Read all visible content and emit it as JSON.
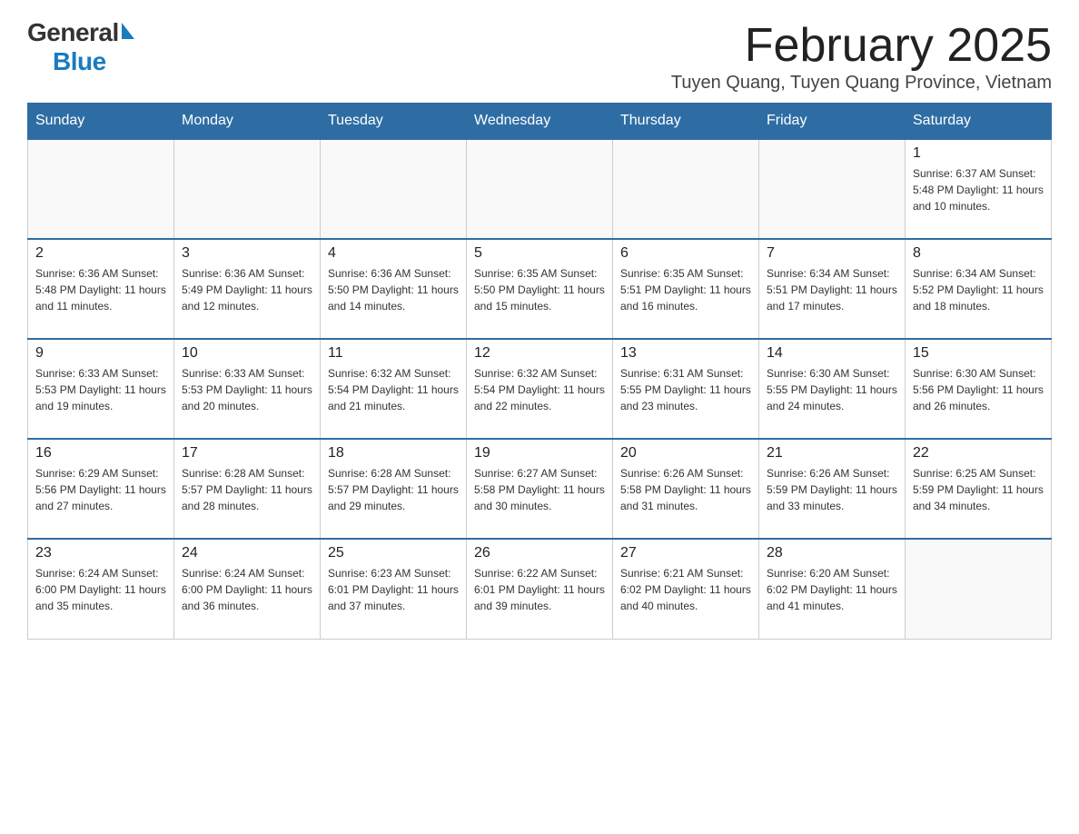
{
  "header": {
    "logo": {
      "general_text": "General",
      "blue_text": "Blue"
    },
    "title": "February 2025",
    "subtitle": "Tuyen Quang, Tuyen Quang Province, Vietnam"
  },
  "days_of_week": [
    "Sunday",
    "Monday",
    "Tuesday",
    "Wednesday",
    "Thursday",
    "Friday",
    "Saturday"
  ],
  "weeks": [
    [
      {
        "day": "",
        "info": ""
      },
      {
        "day": "",
        "info": ""
      },
      {
        "day": "",
        "info": ""
      },
      {
        "day": "",
        "info": ""
      },
      {
        "day": "",
        "info": ""
      },
      {
        "day": "",
        "info": ""
      },
      {
        "day": "1",
        "info": "Sunrise: 6:37 AM\nSunset: 5:48 PM\nDaylight: 11 hours and 10 minutes."
      }
    ],
    [
      {
        "day": "2",
        "info": "Sunrise: 6:36 AM\nSunset: 5:48 PM\nDaylight: 11 hours and 11 minutes."
      },
      {
        "day": "3",
        "info": "Sunrise: 6:36 AM\nSunset: 5:49 PM\nDaylight: 11 hours and 12 minutes."
      },
      {
        "day": "4",
        "info": "Sunrise: 6:36 AM\nSunset: 5:50 PM\nDaylight: 11 hours and 14 minutes."
      },
      {
        "day": "5",
        "info": "Sunrise: 6:35 AM\nSunset: 5:50 PM\nDaylight: 11 hours and 15 minutes."
      },
      {
        "day": "6",
        "info": "Sunrise: 6:35 AM\nSunset: 5:51 PM\nDaylight: 11 hours and 16 minutes."
      },
      {
        "day": "7",
        "info": "Sunrise: 6:34 AM\nSunset: 5:51 PM\nDaylight: 11 hours and 17 minutes."
      },
      {
        "day": "8",
        "info": "Sunrise: 6:34 AM\nSunset: 5:52 PM\nDaylight: 11 hours and 18 minutes."
      }
    ],
    [
      {
        "day": "9",
        "info": "Sunrise: 6:33 AM\nSunset: 5:53 PM\nDaylight: 11 hours and 19 minutes."
      },
      {
        "day": "10",
        "info": "Sunrise: 6:33 AM\nSunset: 5:53 PM\nDaylight: 11 hours and 20 minutes."
      },
      {
        "day": "11",
        "info": "Sunrise: 6:32 AM\nSunset: 5:54 PM\nDaylight: 11 hours and 21 minutes."
      },
      {
        "day": "12",
        "info": "Sunrise: 6:32 AM\nSunset: 5:54 PM\nDaylight: 11 hours and 22 minutes."
      },
      {
        "day": "13",
        "info": "Sunrise: 6:31 AM\nSunset: 5:55 PM\nDaylight: 11 hours and 23 minutes."
      },
      {
        "day": "14",
        "info": "Sunrise: 6:30 AM\nSunset: 5:55 PM\nDaylight: 11 hours and 24 minutes."
      },
      {
        "day": "15",
        "info": "Sunrise: 6:30 AM\nSunset: 5:56 PM\nDaylight: 11 hours and 26 minutes."
      }
    ],
    [
      {
        "day": "16",
        "info": "Sunrise: 6:29 AM\nSunset: 5:56 PM\nDaylight: 11 hours and 27 minutes."
      },
      {
        "day": "17",
        "info": "Sunrise: 6:28 AM\nSunset: 5:57 PM\nDaylight: 11 hours and 28 minutes."
      },
      {
        "day": "18",
        "info": "Sunrise: 6:28 AM\nSunset: 5:57 PM\nDaylight: 11 hours and 29 minutes."
      },
      {
        "day": "19",
        "info": "Sunrise: 6:27 AM\nSunset: 5:58 PM\nDaylight: 11 hours and 30 minutes."
      },
      {
        "day": "20",
        "info": "Sunrise: 6:26 AM\nSunset: 5:58 PM\nDaylight: 11 hours and 31 minutes."
      },
      {
        "day": "21",
        "info": "Sunrise: 6:26 AM\nSunset: 5:59 PM\nDaylight: 11 hours and 33 minutes."
      },
      {
        "day": "22",
        "info": "Sunrise: 6:25 AM\nSunset: 5:59 PM\nDaylight: 11 hours and 34 minutes."
      }
    ],
    [
      {
        "day": "23",
        "info": "Sunrise: 6:24 AM\nSunset: 6:00 PM\nDaylight: 11 hours and 35 minutes."
      },
      {
        "day": "24",
        "info": "Sunrise: 6:24 AM\nSunset: 6:00 PM\nDaylight: 11 hours and 36 minutes."
      },
      {
        "day": "25",
        "info": "Sunrise: 6:23 AM\nSunset: 6:01 PM\nDaylight: 11 hours and 37 minutes."
      },
      {
        "day": "26",
        "info": "Sunrise: 6:22 AM\nSunset: 6:01 PM\nDaylight: 11 hours and 39 minutes."
      },
      {
        "day": "27",
        "info": "Sunrise: 6:21 AM\nSunset: 6:02 PM\nDaylight: 11 hours and 40 minutes."
      },
      {
        "day": "28",
        "info": "Sunrise: 6:20 AM\nSunset: 6:02 PM\nDaylight: 11 hours and 41 minutes."
      },
      {
        "day": "",
        "info": ""
      }
    ]
  ]
}
